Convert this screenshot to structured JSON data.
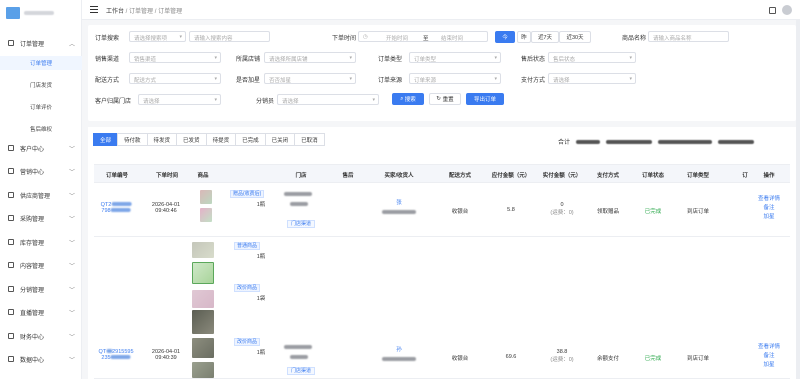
{
  "topbar": {
    "breadcrumbs": [
      "工作台",
      "订单管理",
      "订单管理"
    ]
  },
  "sidebar": {
    "menu": [
      {
        "label": "订单管理",
        "expanded": true
      },
      {
        "label": "客户中心"
      },
      {
        "label": "营销中心"
      },
      {
        "label": "供应商管理"
      },
      {
        "label": "采购管理"
      },
      {
        "label": "库存管理"
      },
      {
        "label": "内容管理"
      },
      {
        "label": "分销管理"
      },
      {
        "label": "直播管理"
      },
      {
        "label": "财务中心"
      },
      {
        "label": "数据中心"
      }
    ],
    "submenu": [
      "订单管理",
      "门店发货",
      "订单评价",
      "售后维权"
    ]
  },
  "filters": {
    "order_search_label": "订单搜索",
    "order_search_select": "请选择搜索项",
    "order_search_input": "请输入搜索内容",
    "order_time_label": "下单时间",
    "start_time": "开始时间",
    "to": "至",
    "end_time": "结束时间",
    "quick_today": "今",
    "quick_yesterday": "昨",
    "quick_7days": "近7天",
    "quick_30days": "近30天",
    "product_name_label": "商品名称",
    "product_name_input": "请输入商品名称",
    "sales_channel_label": "销售渠道",
    "sales_channel_select": "销售渠道",
    "store_label": "所属店铺",
    "store_select": "请选择所属店铺",
    "order_type_label": "订单类型",
    "order_type_select": "订单类型",
    "after_sale_label": "售后状态",
    "after_sale_select": "售后状态",
    "delivery_label": "配送方式",
    "delivery_select": "配送方式",
    "is_gift_label": "是否加星",
    "is_gift_select": "否否加星",
    "order_source_label": "订单来源",
    "order_source_select": "订单来源",
    "pay_method_label": "支付方式",
    "pay_method_select": "请选择",
    "customer_store_label": "客户归属门店",
    "customer_store_select": "请选择",
    "distribution_label": "分销员",
    "distribution_select": "请选择",
    "search_btn": "搜索",
    "reset_btn": "重置",
    "export_btn": "导出订单"
  },
  "tabs": [
    "全部",
    "待付款",
    "待发货",
    "已发货",
    "待提货",
    "已完成",
    "已关闭",
    "已取消"
  ],
  "summary": {
    "label": "合计"
  },
  "table": {
    "headers": [
      "订单编号",
      "下单时间",
      "商品",
      "门店",
      "售后",
      "买家/收货人",
      "配送方式",
      "应付金额（元）",
      "实付金额（元）",
      "支付方式",
      "订单状态",
      "订单类型",
      "订",
      "操作"
    ],
    "rows": [
      {
        "order_no_1": "QT2",
        "order_no_2": "798",
        "date": "2026-04-01",
        "time": "09:40:46",
        "tag": "赠品(收费后)",
        "qty": "1瓶",
        "store_tag": "门店渠道",
        "buyer": "张",
        "delivery": "收银台",
        "payable": "5.8",
        "paid": "0",
        "paid_note": "(运费：0)",
        "pay_method": "领取赠品",
        "status": "已完成",
        "order_type": "到店订单",
        "ops": [
          "查看详情",
          "备注",
          "加星"
        ]
      },
      {
        "order_no_1": "QT",
        "order_no_2": "235",
        "order_no_full_1": "2915595",
        "date": "2026-04-01",
        "time": "09:40:39",
        "tags": [
          "普通商品",
          "改价商品",
          "改价商品"
        ],
        "qtys": [
          "1瓶",
          "1袋",
          "1瓶"
        ],
        "store_tag": "门店渠道",
        "buyer": "孙",
        "delivery": "收银台",
        "payable": "69.6",
        "paid": "38.8",
        "paid_note": "(运费：0)",
        "pay_method": "余额支付",
        "status": "已完成",
        "order_type": "到店订单",
        "ops": [
          "查看详情",
          "备注",
          "加星"
        ]
      }
    ]
  },
  "colors": {
    "primary": "#3a7bf0",
    "success": "#2aa84a"
  }
}
